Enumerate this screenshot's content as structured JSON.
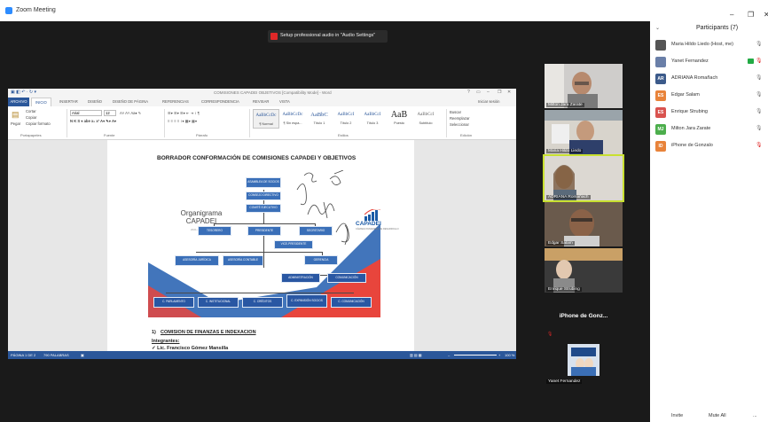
{
  "window": {
    "title": "Zoom Meeting",
    "controls": [
      "–",
      "❐",
      "✕"
    ]
  },
  "banner": {
    "text": "Setup professional audio in \"Audio Settings\""
  },
  "participants": {
    "header": "Participants (7)",
    "list": [
      {
        "name": "Maria Hildo Liedo (Host, me)",
        "initials": "",
        "color": "#555555",
        "mic": "on",
        "cam": false
      },
      {
        "name": "Yanet Fernandez",
        "initials": "",
        "color": "#6a7fa8",
        "mic": "muted",
        "cam": true
      },
      {
        "name": "ADRIANA Romañach",
        "initials": "AR",
        "color": "#3b5a8a",
        "mic": "on",
        "cam": false
      },
      {
        "name": "Edgar Salam",
        "initials": "ES",
        "color": "#e8833a",
        "mic": "on",
        "cam": false
      },
      {
        "name": "Enrique Strubing",
        "initials": "ES",
        "color": "#d9534f",
        "mic": "on",
        "cam": false
      },
      {
        "name": "Milton Jara Zarate",
        "initials": "MJ",
        "color": "#4cae4c",
        "mic": "on",
        "cam": false
      },
      {
        "name": "iPhone de Gonzalo",
        "initials": "ID",
        "color": "#e8833a",
        "mic": "muted",
        "cam": false
      }
    ],
    "footer": {
      "invite": "Invite",
      "mute_all": "Mute All",
      "more": "..."
    }
  },
  "word": {
    "doc_title": "COMISIONES CAPADEI OBJETIVOS [Compatibility Mode] - Word",
    "sign_in": "Iniciar sesión",
    "tabs": [
      "ARCHIVO",
      "INICIO",
      "INSERTAR",
      "DISEÑO",
      "DISEÑO DE PÁGINA",
      "REFERENCIAS",
      "CORRESPONDENCIA",
      "REVISAR",
      "VISTA"
    ],
    "ribbon": {
      "paste": "Pegar",
      "cut": "Cortar",
      "copy": "Copiar",
      "format_painter": "Copiar formato",
      "font": "Arial",
      "size": "12",
      "find": "Buscar",
      "replace": "Reemplazar",
      "select": "Seleccionar",
      "groups": [
        "Portapapeles",
        "Fuente",
        "Párrafo",
        "Estilos",
        "Edición"
      ],
      "styles": [
        {
          "sample": "AaBbCcDc",
          "name": "¶ Normal"
        },
        {
          "sample": "AaBbCcDc",
          "name": "¶ Sin espa..."
        },
        {
          "sample": "AaBbC",
          "name": "Título 1"
        },
        {
          "sample": "AaBbCcI",
          "name": "Título 2"
        },
        {
          "sample": "AaBbCcI",
          "name": "Título 3"
        },
        {
          "sample": "AaB",
          "name": "Puesto"
        },
        {
          "sample": "AaBbCcI",
          "name": "Subtítulo"
        }
      ]
    },
    "heading": "BORRADOR CONFORMACIÓN DE COMISIONES CAPADEI Y OBJETIVOS",
    "org": {
      "title": "Organigrama CAPADEI",
      "subtitle": "2021-2022",
      "logo": "CAPADEI",
      "logo_sub": "CÁMARA PANAMEÑA DE DESARROLLO",
      "boxes": {
        "asamblea": "ASAMBLEA DE SOCIOS",
        "consejo": "CONSEJO DIRECTIVO",
        "comite": "COMITÉ EJECUTIVO",
        "tesorero": "TESORERO",
        "presidente": "PRESIDENTE",
        "secretario": "SECRETARIO",
        "vicepresidente": "VICE-PRESIDENTE",
        "asesoria_juridica": "ASESORÍA JURÍDICA",
        "asesoria_contable": "ASESORÍA CONTABLE",
        "gerencia": "GERENCIA",
        "administracion": "ADMINISTRACIÓN",
        "comunicacion": "COMUNICACIÓN",
        "c_parlamento": "C. PARLAMENTO",
        "c_institucional": "C. INSTITUCIONAL",
        "c_creditos": "C. CRÉDITOS",
        "c_expansion": "C. EXPANSIÓN SOCIOS",
        "c_comunicacion": "C. COMUNICACIÓN"
      }
    },
    "section": {
      "number": "1)",
      "title": "COMISION DE FINANZAS E INDEXACION",
      "integrantes": "Integrantes:",
      "first_member": "✓  Lic. Francisco Gómez Mansilla"
    },
    "status": {
      "page": "PÁGINA 1 DE 2",
      "words": "790 PALABRAS",
      "zoom": "100 %"
    }
  },
  "video_tiles": [
    {
      "name": "Milton Jara Zarate",
      "active": false
    },
    {
      "name": "Maria Hildo Liedo",
      "active": false
    },
    {
      "name": "ADRIANA Romañach",
      "active": true
    },
    {
      "name": "Edgar Salam",
      "active": false
    },
    {
      "name": "Enrique Strubing",
      "active": false
    },
    {
      "name": "iPhone de Gonz...",
      "active": false
    },
    {
      "name": "Yanet Fernandez",
      "active": false
    }
  ]
}
